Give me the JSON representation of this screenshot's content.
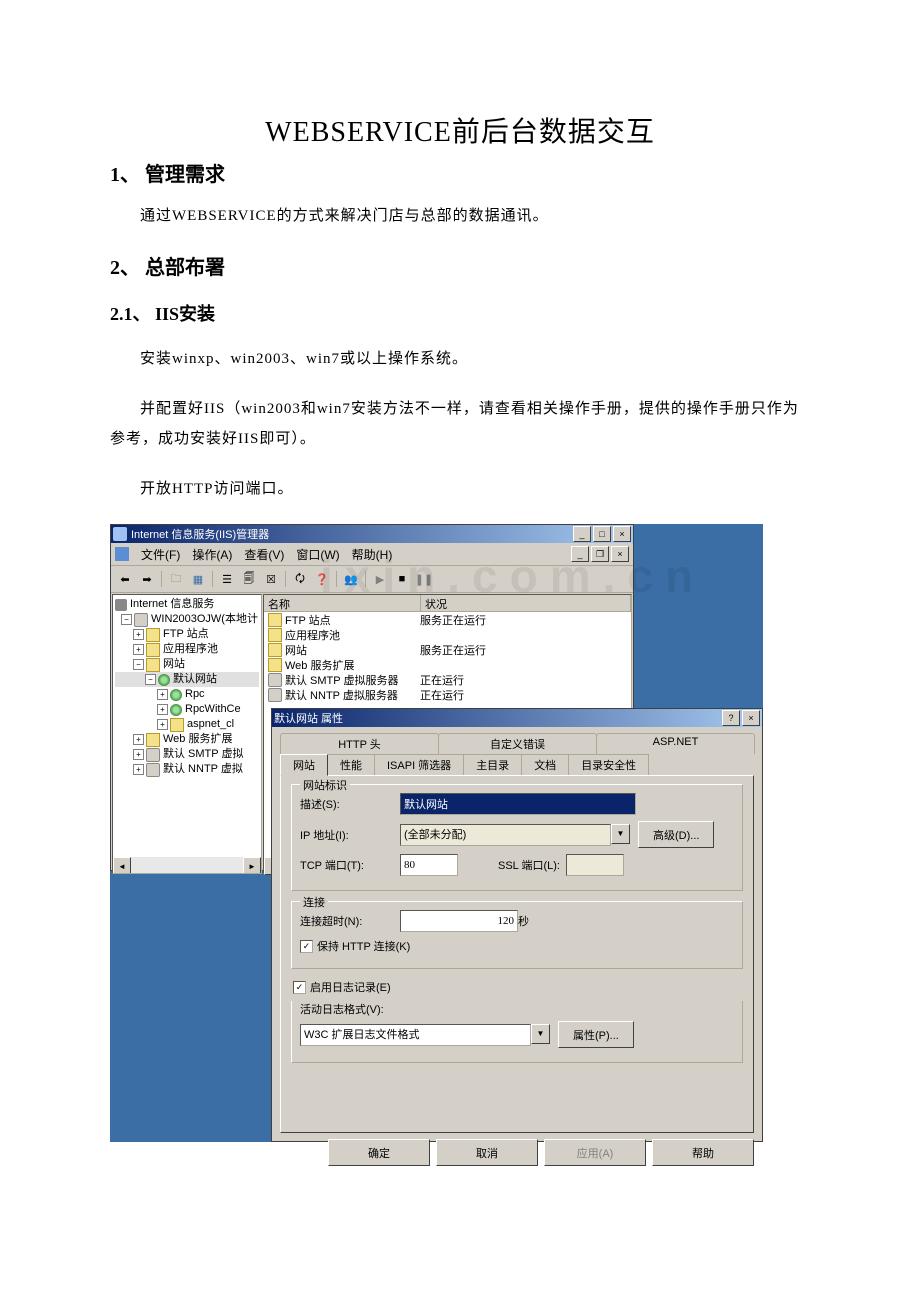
{
  "doc": {
    "title": "WEBSERVICE前后台数据交互",
    "h1": "1、  管理需求",
    "p1": "通过WEBSERVICE的方式来解决门店与总部的数据通讯。",
    "h2": "2、  总部布署",
    "h21": "2.1、   IIS安装",
    "p2": "安装winxp、win2003、win7或以上操作系统。",
    "p3": "并配置好IIS（win2003和win7安装方法不一样，请查看相关操作手册，提供的操作手册只作为参考，成功安装好IIS即可）。",
    "p4": "开放HTTP访问端口。",
    "watermark": "ixin.com.cn"
  },
  "iis": {
    "title": "Internet 信息服务(IIS)管理器",
    "menu": {
      "file": "文件(F)",
      "action": "操作(A)",
      "view": "查看(V)",
      "window": "窗口(W)",
      "help": "帮助(H)"
    },
    "tree": {
      "root": "Internet 信息服务",
      "host": "WIN2003OJW(本地计",
      "ftp": "FTP 站点",
      "apppool": "应用程序池",
      "websites": "网站",
      "defaultsite": "默认网站",
      "rpc": "Rpc",
      "rpcwithce": "RpcWithCe",
      "aspnet": "aspnet_cl",
      "webext": "Web 服务扩展",
      "smtp": "默认 SMTP 虚拟",
      "nntp": "默认 NNTP 虚拟"
    },
    "list": {
      "col_name": "名称",
      "col_status": "状况",
      "r1_name": "FTP 站点",
      "r1_status": "服务正在运行",
      "r2_name": "应用程序池",
      "r3_name": "网站",
      "r3_status": "服务正在运行",
      "r4_name": "Web 服务扩展",
      "r5_name": "默认 SMTP 虚拟服务器",
      "r5_status": "正在运行",
      "r6_name": "默认 NNTP 虚拟服务器",
      "r6_status": "正在运行"
    }
  },
  "prop": {
    "title": "默认网站 属性",
    "tabs_row1": {
      "http": "HTTP 头",
      "error": "自定义错误",
      "aspnet": "ASP.NET"
    },
    "tabs_row2": {
      "site": "网站",
      "perf": "性能",
      "isapi": "ISAPI 筛选器",
      "home": "主目录",
      "doc": "文档",
      "sec": "目录安全性"
    },
    "group_site": "网站标识",
    "lbl_desc": "描述(S):",
    "val_desc": "默认网站",
    "lbl_ip": "IP 地址(I):",
    "val_ip": "(全部未分配)",
    "btn_adv": "高级(D)...",
    "lbl_tcp": "TCP 端口(T):",
    "val_tcp": "80",
    "lbl_ssl": "SSL 端口(L):",
    "val_ssl": "",
    "group_conn": "连接",
    "lbl_timeout": "连接超时(N):",
    "val_timeout": "120",
    "lbl_sec": " 秒",
    "chk_keepalive": "保持 HTTP 连接(K)",
    "chk_log": "启用日志记录(E)",
    "lbl_logformat": "活动日志格式(V):",
    "val_logformat": "W3C 扩展日志文件格式",
    "btn_logprop": "属性(P)...",
    "btn_ok": "确定",
    "btn_cancel": "取消",
    "btn_apply": "应用(A)",
    "btn_help": "帮助"
  }
}
